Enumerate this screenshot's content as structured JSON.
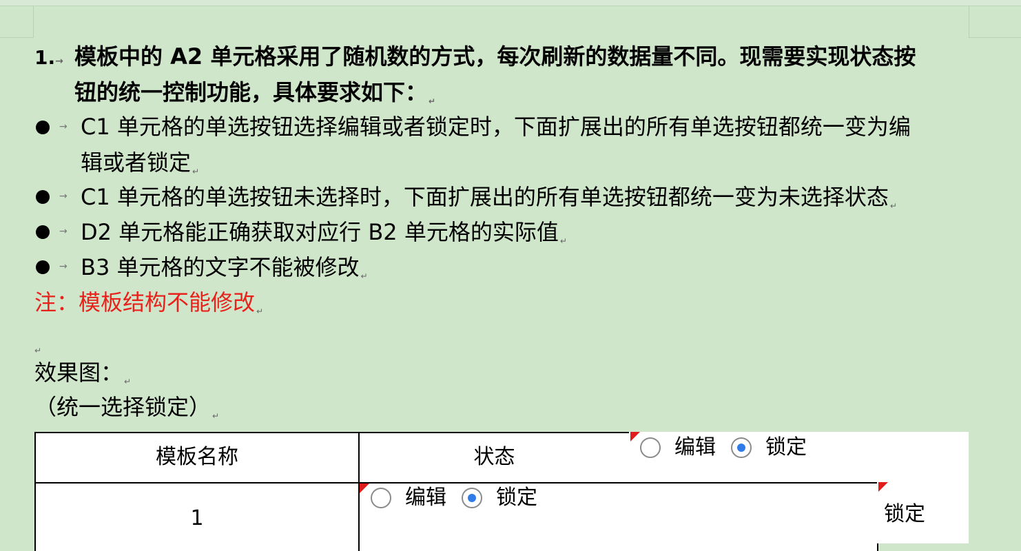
{
  "doc": {
    "item_number": "1.",
    "title_line1": "模板中的 A2 单元格采用了随机数的方式，每次刷新的数据量不同。现需要实现状态按",
    "title_line2": "钮的统一控制功能，具体要求如下：",
    "bullets": [
      {
        "line1": "C1 单元格的单选按钮选择编辑或者锁定时，下面扩展出的所有单选按钮都统一变为编",
        "line2": "辑或者锁定"
      },
      {
        "line1": "C1 单元格的单选按钮未选择时，下面扩展出的所有单选按钮都统一变为未选择状态"
      },
      {
        "line1": "D2 单元格能正确获取对应行 B2 单元格的实际值"
      },
      {
        "line1": "B3 单元格的文字不能被修改"
      }
    ],
    "note": "注：模板结构不能修改",
    "effect_heading": "效果图：",
    "effect_caption": "（统一选择锁定）"
  },
  "table": {
    "header_col1": "模板名称",
    "header_col2": "状态",
    "row1_col1": "1",
    "radio_edit_label": "编辑",
    "radio_lock_label": "锁定",
    "row1_value": "锁定"
  },
  "colors": {
    "background": "#cfe6cb",
    "note_red": "#e8211b",
    "radio_blue": "#2f7be8"
  }
}
